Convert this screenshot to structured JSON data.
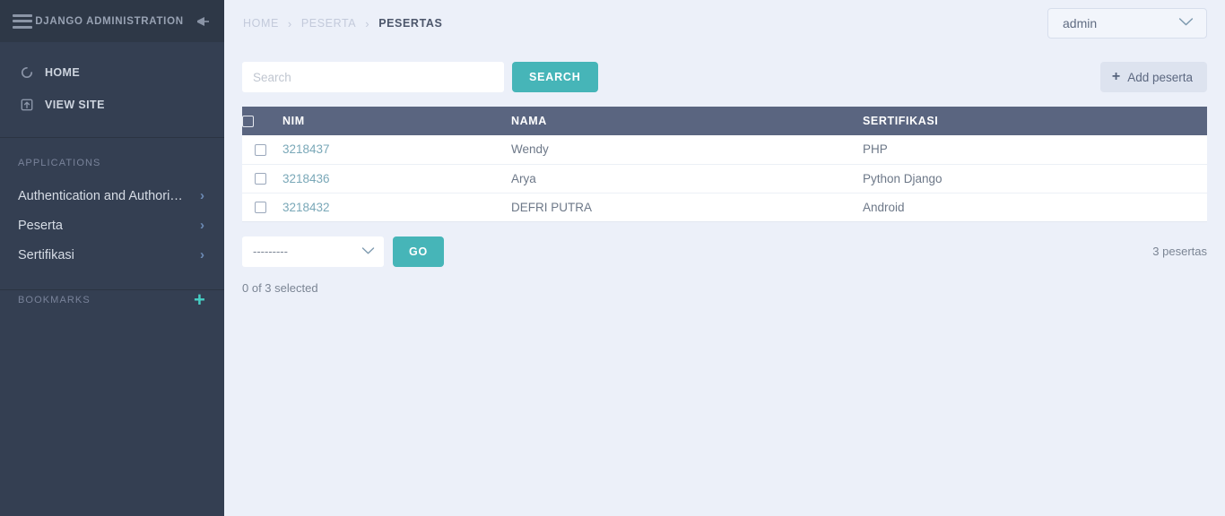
{
  "sidebar": {
    "brand": "DJANGO ADMINISTRATION",
    "menu_icon": "hamburger-icon",
    "pin_icon": "pin-icon",
    "nav": [
      {
        "label": "HOME",
        "icon": "home-circle-icon"
      },
      {
        "label": "VIEW SITE",
        "icon": "external-link-icon"
      }
    ],
    "applications_title": "APPLICATIONS",
    "applications": [
      {
        "label": "Authentication and Authoriz…",
        "chevron": "chevron-right-icon"
      },
      {
        "label": "Peserta",
        "chevron": "chevron-right-icon"
      },
      {
        "label": "Sertifikasi",
        "chevron": "chevron-right-icon"
      }
    ],
    "bookmarks_title": "BOOKMARKS",
    "bookmarks_add_icon": "plus-icon"
  },
  "topbar": {
    "breadcrumb": [
      {
        "label": "HOME",
        "current": false
      },
      {
        "label": "PESERTA",
        "current": false
      },
      {
        "label": "PESERTAS",
        "current": true
      }
    ],
    "separator": "›",
    "user": {
      "name": "admin",
      "chevron": "chevron-down-icon"
    }
  },
  "toolbar": {
    "search_value": "",
    "search_placeholder": "Search",
    "search_button": "SEARCH",
    "add_button": "Add peserta",
    "add_icon": "plus-icon"
  },
  "table": {
    "select_all_icon": "checkbox-unchecked-icon",
    "columns": [
      "NIM",
      "NAMA",
      "SERTIFIKASI"
    ],
    "rows": [
      {
        "nim": "3218437",
        "nama": "Wendy",
        "sertifikasi": "PHP"
      },
      {
        "nim": "3218436",
        "nama": "Arya",
        "sertifikasi": "Python Django"
      },
      {
        "nim": "3218432",
        "nama": "DEFRI PUTRA",
        "sertifikasi": "Android"
      }
    ]
  },
  "actions": {
    "select_value": "---------",
    "select_options": [
      "---------"
    ],
    "go_button": "GO",
    "selected_text": "0 of 3 selected",
    "counter": "3 pesertas"
  },
  "colors": {
    "sidebar_bg": "#343f52",
    "sidebar_header_bg": "#2e3847",
    "content_bg": "#ecf0f9",
    "accent_teal": "#46b5b8",
    "bookmark_plus": "#46cfc4",
    "table_header_bg": "#5a6580",
    "link_blue": "#7aa8b8"
  }
}
